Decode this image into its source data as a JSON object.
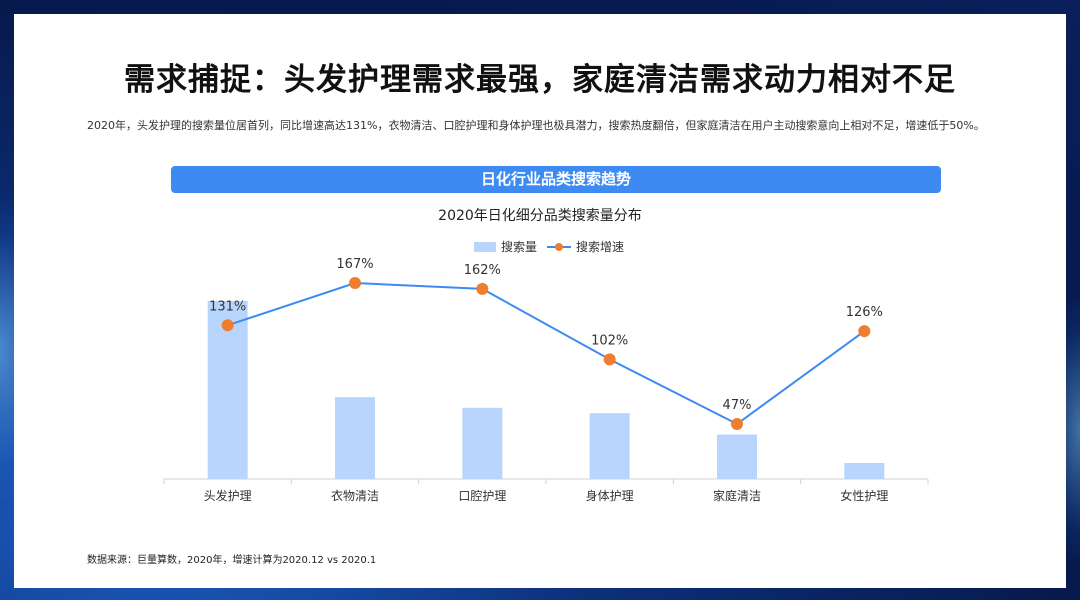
{
  "page": {
    "title": "需求捕捉：头发护理需求最强，家庭清洁需求动力相对不足",
    "description": "2020年，头发护理的搜索量位居首列，同比增速高达131%，衣物清洁、口腔护理和身体护理也极具潜力，搜索热度翻倍，但家庭清洁在用户主动搜索意向上相对不足，增速低于50%。",
    "banner": "日化行业品类搜索趋势",
    "source": "数据来源：巨量算数，2020年，增速计算为2020.12 vs 2020.1"
  },
  "colors": {
    "bar": "#b8d6fd",
    "line": "#3d8bf2",
    "marker": "#ef7d2d",
    "banner": "#3d8bf2"
  },
  "chart_data": {
    "type": "bar",
    "title": "2020年日化细分品类搜索量分布",
    "categories": [
      "头发护理",
      "衣物清洁",
      "口腔护理",
      "身体护理",
      "家庭清洁",
      "女性护理"
    ],
    "series": [
      {
        "name": "搜索量",
        "type": "bar",
        "values": [
          100,
          46,
          40,
          37,
          25,
          9
        ]
      },
      {
        "name": "搜索增速",
        "type": "line",
        "values": [
          131,
          167,
          162,
          102,
          47,
          126
        ],
        "labels": [
          "131%",
          "167%",
          "162%",
          "102%",
          "47%",
          "126%"
        ]
      }
    ],
    "legend_position": "top-center",
    "grid": false
  }
}
